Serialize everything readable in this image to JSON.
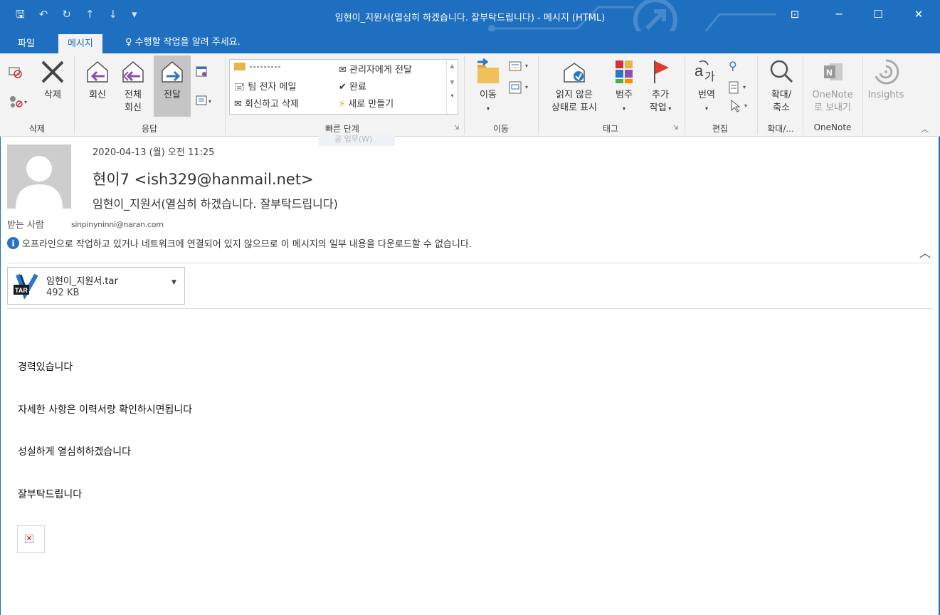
{
  "window": {
    "title": "임현이_지원서(열심히 하겠습니다. 잘부탁드립니다) - 메시지 (HTML)",
    "qat": {
      "save": "🖫",
      "undo": "↶",
      "redo": "↻",
      "up": "↑",
      "down": "↓",
      "more": "▾"
    },
    "controls": {
      "ribbon_options": "⊡",
      "minimize": "─",
      "maximize": "☐",
      "close": "✕"
    }
  },
  "ribbon_tabs": {
    "file": "파일",
    "message": "메시지",
    "tell_me": "수행할 작업을 알려 주세요."
  },
  "ribbon": {
    "delete_group": {
      "label": "삭제",
      "delete_button": "삭제"
    },
    "respond_group": {
      "label": "응답",
      "reply": "회신",
      "reply_all_1": "전체",
      "reply_all_2": "회신",
      "forward": "전달"
    },
    "quick_steps_group": {
      "label": "빠른 단계",
      "items": [
        "팀 전자 메일",
        "회신하고 삭제",
        "관리자에게 전달",
        "완료",
        "새로 만들기"
      ],
      "ghost": "공 업무(W)"
    },
    "move_group": {
      "label": "이동",
      "move": "이동"
    },
    "tags_group": {
      "label": "태그",
      "mark_unread_1": "읽지 않은",
      "mark_unread_2": "상태로 표시",
      "categorize": "범주",
      "follow_up_1": "추가",
      "follow_up_2": "작업"
    },
    "editing_group": {
      "label": "편집",
      "translate": "번역"
    },
    "zoom_group": {
      "label": "확대/...",
      "zoom_1": "확대/",
      "zoom_2": "축소"
    },
    "onenote_group": {
      "label": "OneNote",
      "send_1": "OneNote",
      "send_2": "로 보내기"
    },
    "insights_group": {
      "insights": "Insights"
    }
  },
  "message": {
    "date": "2020-04-13 (월) 오전 11:25",
    "sender": "현이7 <ish329@hanmail.net>",
    "subject": "임현이_지원서(열심히 하겠습니다. 잘부탁드립니다)",
    "to_label": "받는 사람",
    "to_value": "sinpinyninni@naran.com",
    "info": "오프라인으로 작업하고 있거나 네트워크에 연결되어 있지 않으므로 이 메시지의 일부 내용을 다운로드할 수 없습니다.",
    "attachment": {
      "name": "임현이_지원서.tar",
      "size": "492 KB",
      "badge": "TAR"
    },
    "body": [
      "경력있습니다",
      "자세한 사항은 이력서랑 확인하시면됩니다",
      "성실하게 열심히하겠습니다",
      "잘부탁드립니다"
    ]
  },
  "colors": {
    "accent": "#1e6fbf",
    "ribbon_bg": "#f3f3f3",
    "reply_purple": "#8b4fb8",
    "forward_blue": "#2a76c9",
    "flag_red": "#e03a2a"
  }
}
